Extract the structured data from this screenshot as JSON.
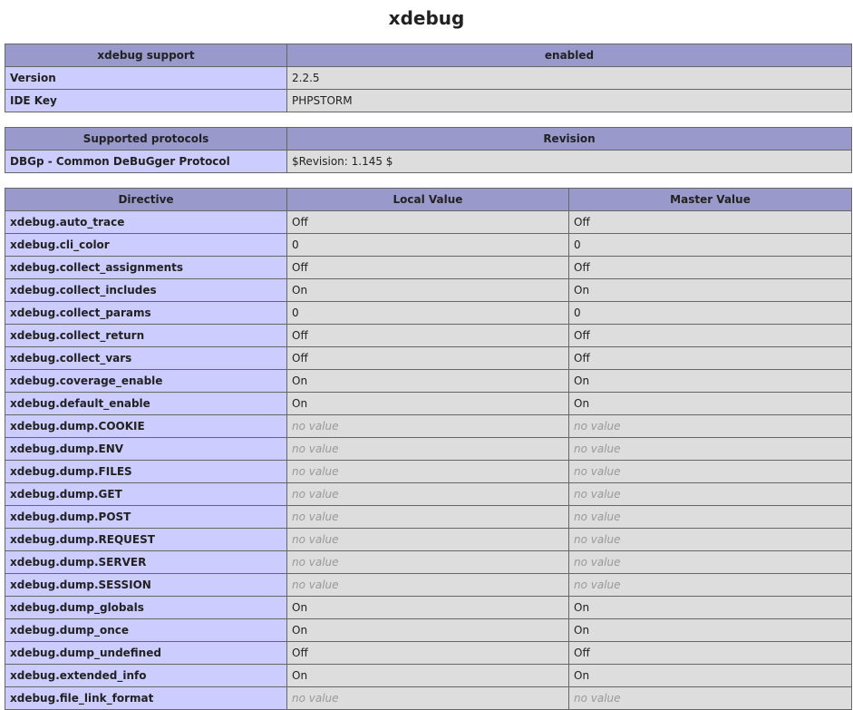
{
  "page": {
    "title": "xdebug"
  },
  "support_table": {
    "header": [
      "xdebug support",
      "enabled"
    ],
    "rows": [
      {
        "name": "Version",
        "value": "2.2.5"
      },
      {
        "name": "IDE Key",
        "value": "PHPSTORM"
      }
    ]
  },
  "protocols_table": {
    "header": [
      "Supported protocols",
      "Revision"
    ],
    "rows": [
      {
        "name": "DBGp - Common DeBuGger Protocol",
        "value": "$Revision: 1.145 $"
      }
    ]
  },
  "directives_table": {
    "header": [
      "Directive",
      "Local Value",
      "Master Value"
    ],
    "rows": [
      {
        "name": "xdebug.auto_trace",
        "local": "Off",
        "master": "Off"
      },
      {
        "name": "xdebug.cli_color",
        "local": "0",
        "master": "0"
      },
      {
        "name": "xdebug.collect_assignments",
        "local": "Off",
        "master": "Off"
      },
      {
        "name": "xdebug.collect_includes",
        "local": "On",
        "master": "On"
      },
      {
        "name": "xdebug.collect_params",
        "local": "0",
        "master": "0"
      },
      {
        "name": "xdebug.collect_return",
        "local": "Off",
        "master": "Off"
      },
      {
        "name": "xdebug.collect_vars",
        "local": "Off",
        "master": "Off"
      },
      {
        "name": "xdebug.coverage_enable",
        "local": "On",
        "master": "On"
      },
      {
        "name": "xdebug.default_enable",
        "local": "On",
        "master": "On"
      },
      {
        "name": "xdebug.dump.COOKIE",
        "local": "no value",
        "master": "no value"
      },
      {
        "name": "xdebug.dump.ENV",
        "local": "no value",
        "master": "no value"
      },
      {
        "name": "xdebug.dump.FILES",
        "local": "no value",
        "master": "no value"
      },
      {
        "name": "xdebug.dump.GET",
        "local": "no value",
        "master": "no value"
      },
      {
        "name": "xdebug.dump.POST",
        "local": "no value",
        "master": "no value"
      },
      {
        "name": "xdebug.dump.REQUEST",
        "local": "no value",
        "master": "no value"
      },
      {
        "name": "xdebug.dump.SERVER",
        "local": "no value",
        "master": "no value"
      },
      {
        "name": "xdebug.dump.SESSION",
        "local": "no value",
        "master": "no value"
      },
      {
        "name": "xdebug.dump_globals",
        "local": "On",
        "master": "On"
      },
      {
        "name": "xdebug.dump_once",
        "local": "On",
        "master": "On"
      },
      {
        "name": "xdebug.dump_undefined",
        "local": "Off",
        "master": "Off"
      },
      {
        "name": "xdebug.extended_info",
        "local": "On",
        "master": "On"
      },
      {
        "name": "xdebug.file_link_format",
        "local": "no value",
        "master": "no value"
      }
    ]
  },
  "colors": {
    "header_bg": "#9999cc",
    "key_cell_bg": "#ccccff",
    "value_cell_bg": "#dddddd",
    "no_value_text": "#999999",
    "border": "#666666"
  }
}
